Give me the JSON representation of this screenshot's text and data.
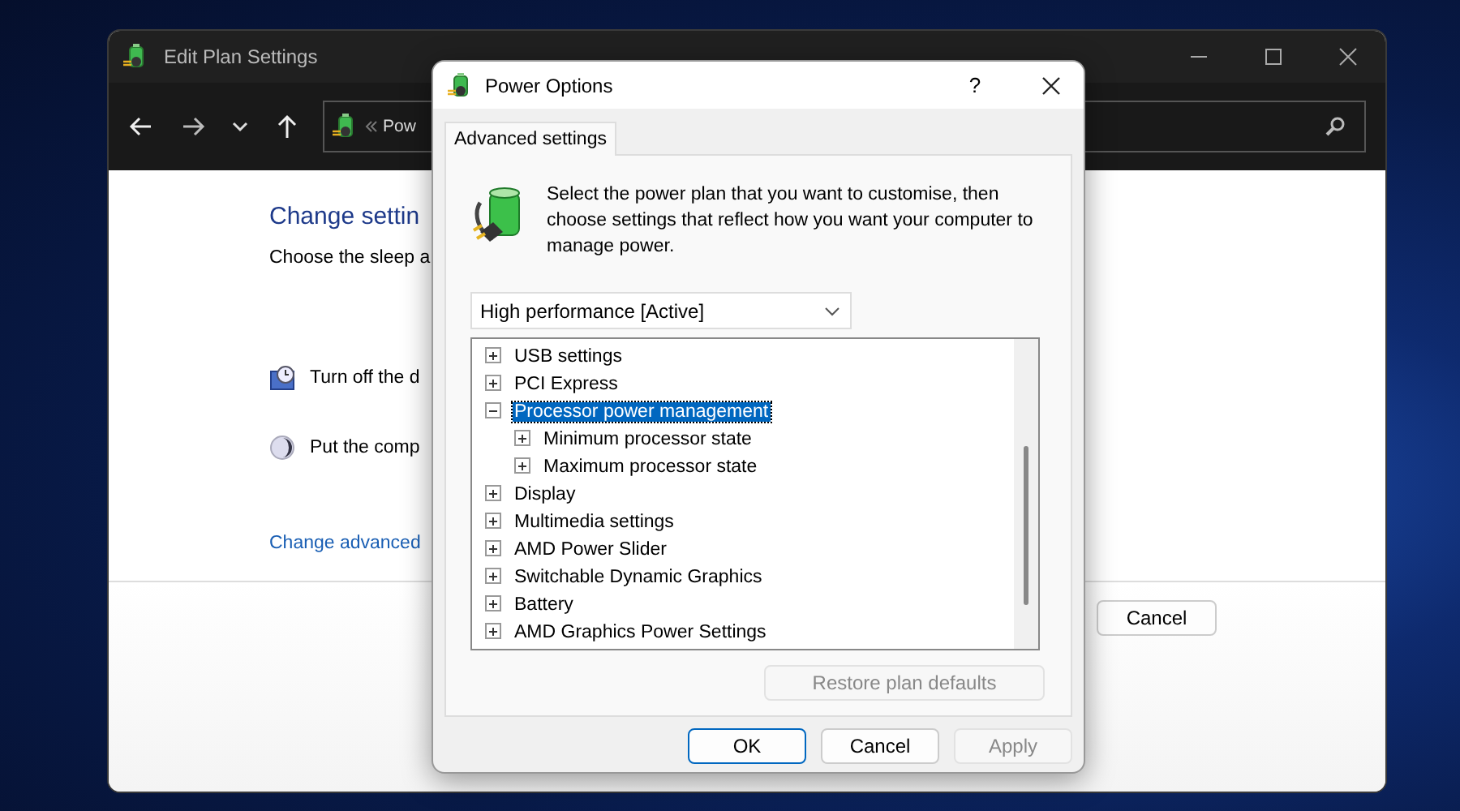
{
  "back_window": {
    "title": "Edit Plan Settings",
    "address": "Pow",
    "heading": "Change settin",
    "subheading": "Choose the sleep a",
    "settings": [
      {
        "label": "Turn off the d",
        "kind": "display"
      },
      {
        "label": "Put the comp",
        "kind": "sleep"
      }
    ],
    "link": "Change advanced",
    "buttons": [
      "Cancel"
    ]
  },
  "dialog": {
    "title": "Power Options",
    "help": "?",
    "tabs": [
      {
        "label": "Advanced settings",
        "selected": true
      }
    ],
    "description": "Select the power plan that you want to customise, then choose settings that reflect how you want your computer to manage power.",
    "plan": "High performance [Active]",
    "tree": [
      {
        "label": "USB settings",
        "expanded": false,
        "selected": false
      },
      {
        "label": "PCI Express",
        "expanded": false,
        "selected": false
      },
      {
        "label": "Processor power management",
        "expanded": true,
        "selected": true,
        "children": [
          {
            "label": "Minimum processor state",
            "expanded": false,
            "selected": false
          },
          {
            "label": "Maximum processor state",
            "expanded": false,
            "selected": false
          }
        ]
      },
      {
        "label": "Display",
        "expanded": false,
        "selected": false
      },
      {
        "label": "Multimedia settings",
        "expanded": false,
        "selected": false
      },
      {
        "label": "AMD Power Slider",
        "expanded": false,
        "selected": false
      },
      {
        "label": "Switchable Dynamic Graphics",
        "expanded": false,
        "selected": false
      },
      {
        "label": "Battery",
        "expanded": false,
        "selected": false
      },
      {
        "label": "AMD Graphics Power Settings",
        "expanded": false,
        "selected": false
      }
    ],
    "restore_button": {
      "label": "Restore plan defaults",
      "disabled": true
    },
    "buttons": [
      {
        "label": "OK",
        "default": true,
        "disabled": false
      },
      {
        "label": "Cancel",
        "default": false,
        "disabled": false
      },
      {
        "label": "Apply",
        "default": false,
        "disabled": true
      }
    ]
  }
}
